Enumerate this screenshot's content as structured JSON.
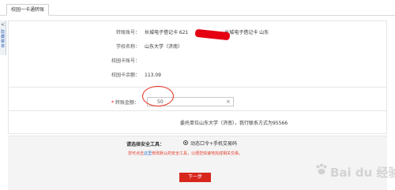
{
  "tab": {
    "label": "校园一卡通转账"
  },
  "sidebar": {
    "arrow": "<",
    "label": "隐藏菜单"
  },
  "info": {
    "transfer_account": {
      "label": "转账账号：",
      "value_prefix": "长城电子借记卡 621",
      "value_suffix": "长城电子借记卡 山东"
    },
    "school": {
      "label": "学校名称：",
      "value": "山东大学（济南）"
    },
    "card_no": {
      "label": "校园卡账号：",
      "value": ""
    },
    "card_balance": {
      "label": "校园卡余额：",
      "value": "113.09"
    }
  },
  "amount": {
    "required_mark": "*",
    "label": "转账金额：",
    "value": "50",
    "clear_icon": "×"
  },
  "notice": {
    "text": "委托单位山东大学（济南），我行联系方式为95566"
  },
  "security": {
    "title": "请选择安全工具：",
    "option": "动态口令+手机交易码",
    "tip_prefix": "您可点击",
    "tip_link": "这里",
    "tip_suffix": "修改默认的安全工具，以便您快速地完成相关交易。"
  },
  "next_button": {
    "label": "下一步"
  },
  "watermark": {
    "text": "Bai du 经验"
  },
  "colors": {
    "accent_red": "#d7261c",
    "link_blue": "#2a6fc9"
  }
}
